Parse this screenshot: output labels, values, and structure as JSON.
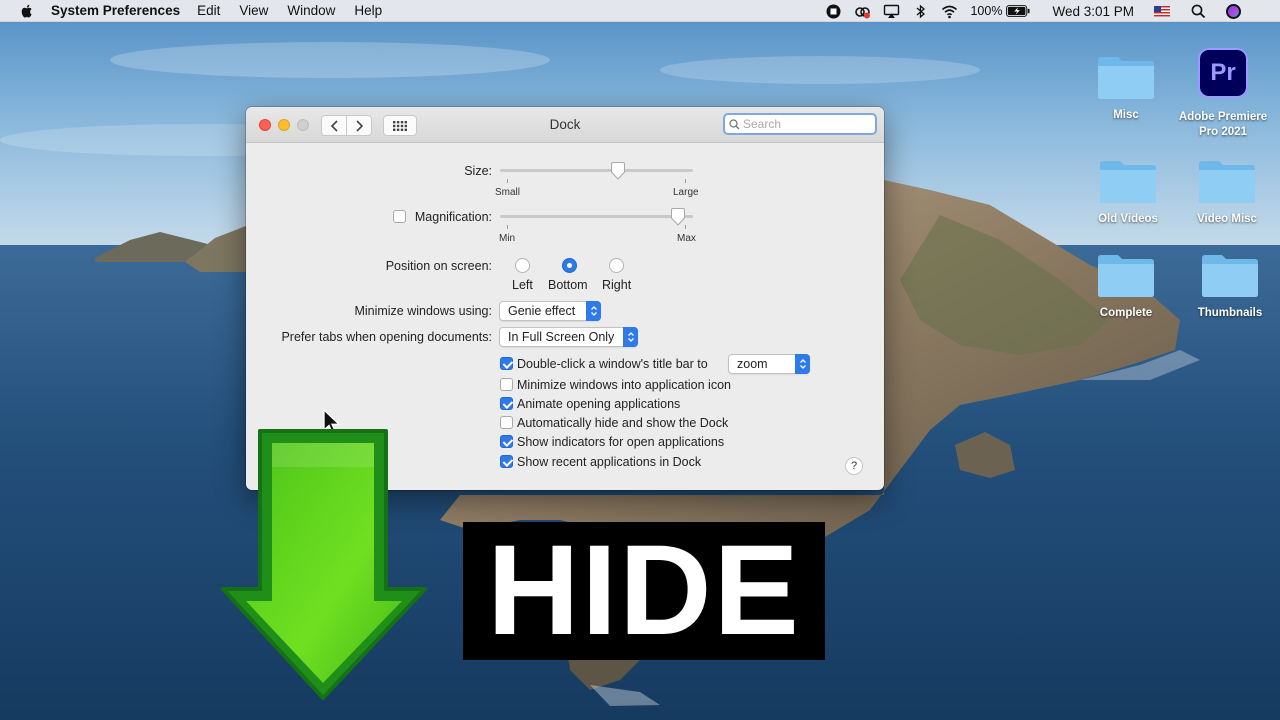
{
  "menubar": {
    "app_name": "System Preferences",
    "items": [
      "Edit",
      "View",
      "Window",
      "Help"
    ],
    "battery": "100%",
    "clock": "Wed 3:01 PM"
  },
  "desktop": {
    "icons": [
      {
        "label": "Misc",
        "type": "folder"
      },
      {
        "label": "Adobe Premiere Pro 2021",
        "type": "app",
        "badge": "Pr"
      },
      {
        "label": "Old Videos",
        "type": "folder"
      },
      {
        "label": "Video Misc",
        "type": "folder"
      },
      {
        "label": "Complete",
        "type": "folder"
      },
      {
        "label": "Thumbnails",
        "type": "folder"
      }
    ]
  },
  "window": {
    "title": "Dock",
    "search_placeholder": "Search",
    "size": {
      "label": "Size:",
      "min_label": "Small",
      "max_label": "Large",
      "value": 0.62
    },
    "magnification": {
      "label": "Magnification:",
      "checked": false,
      "min_label": "Min",
      "max_label": "Max",
      "value": 0.96
    },
    "position": {
      "label": "Position on screen:",
      "options": [
        "Left",
        "Bottom",
        "Right"
      ],
      "selected": "Bottom"
    },
    "minimize": {
      "label": "Minimize windows using:",
      "value": "Genie effect"
    },
    "prefer_tabs": {
      "label": "Prefer tabs when opening documents:",
      "value": "In Full Screen Only"
    },
    "options": [
      {
        "label": "Double-click a window's title bar to",
        "checked": true,
        "popup": "zoom"
      },
      {
        "label": "Minimize windows into application icon",
        "checked": false
      },
      {
        "label": "Animate opening applications",
        "checked": true
      },
      {
        "label": "Automatically hide and show the Dock",
        "checked": false
      },
      {
        "label": "Show indicators for open applications",
        "checked": true
      },
      {
        "label": "Show recent applications in Dock",
        "checked": true
      }
    ],
    "help": "?"
  },
  "overlay": {
    "caption": "HIDE"
  },
  "colors": {
    "accent": "#2d7ae8",
    "arrow_green": "#5bd41c",
    "arrow_dark_green": "#1f8f1a"
  }
}
